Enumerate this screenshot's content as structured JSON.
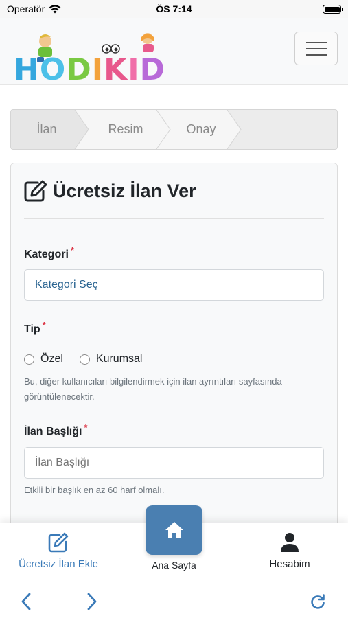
{
  "status_bar": {
    "carrier": "Operatör",
    "time": "ÖS 7:14"
  },
  "header": {
    "logo_text": "HODIKIDS",
    "menu_icon": "hamburger-icon"
  },
  "stepper": {
    "steps": [
      {
        "label": "İlan",
        "active": true
      },
      {
        "label": "Resim",
        "active": false
      },
      {
        "label": "Onay",
        "active": false
      }
    ]
  },
  "form": {
    "title": "Ücretsiz İlan Ver",
    "title_icon": "edit-icon",
    "category": {
      "label": "Kategori",
      "required": "*",
      "value": "Kategori Seç"
    },
    "type": {
      "label": "Tip",
      "required": "*",
      "options": [
        "Özel",
        "Kurumsal"
      ],
      "help": "Bu, diğer kullanıcıları bilgilendirmek için ilan ayrıntıları sayfasında görüntülenecektir."
    },
    "ad_title": {
      "label": "İlan Başlığı",
      "required": "*",
      "placeholder": "İlan Başlığı",
      "help": "Etkili bir başlık en az 60 harf olmalı."
    }
  },
  "bottom_nav": {
    "add_listing": {
      "label": "Ücretsiz İlan Ekle",
      "icon": "edit-icon",
      "color": "#3a7ab8"
    },
    "home": {
      "label": "Ana Sayfa",
      "icon": "home-icon",
      "color": "#4a7fb1"
    },
    "account": {
      "label": "Hesabim",
      "icon": "user-icon"
    }
  },
  "toolbar": {
    "back_icon": "chevron-left-icon",
    "forward_icon": "chevron-right-icon",
    "reload_icon": "reload-icon",
    "accent": "#3a7ab8"
  }
}
